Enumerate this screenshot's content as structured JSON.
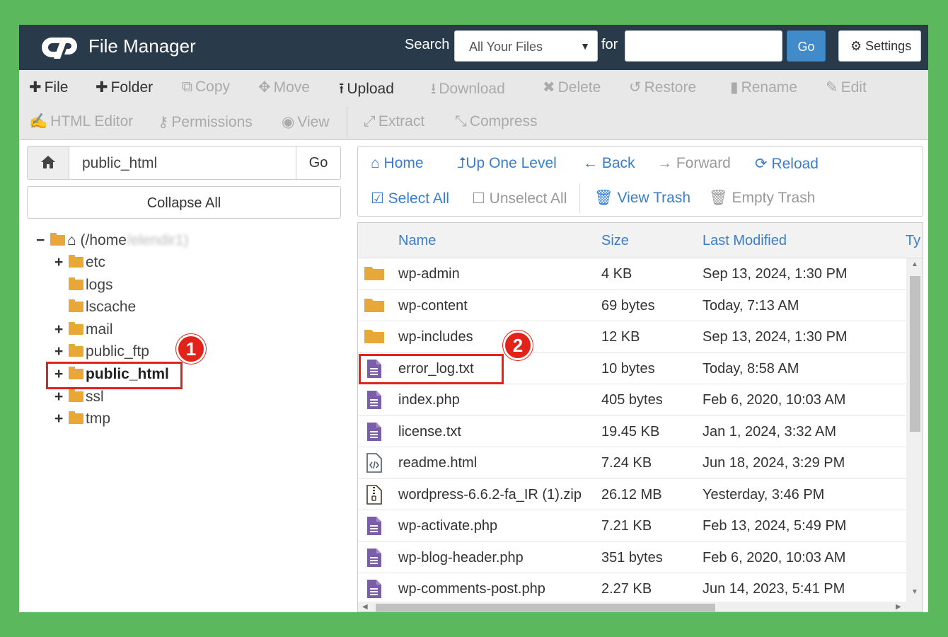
{
  "colors": {
    "background": "#5cb85c",
    "header": "#293a4a",
    "link": "#3a7dc9",
    "highlight": "#e2231a",
    "folder": "#e8a838",
    "file": "#7b5ea8"
  },
  "header": {
    "app_title": "File Manager",
    "search_label": "Search",
    "search_scope": "All Your Files",
    "for_label": "for",
    "search_value": "",
    "go": "Go",
    "settings": "Settings"
  },
  "toolbar": [
    {
      "label": "File",
      "icon": "plus-icon",
      "enabled": true
    },
    {
      "label": "Folder",
      "icon": "plus-icon",
      "enabled": true
    },
    {
      "label": "Copy",
      "icon": "copy-icon",
      "enabled": false
    },
    {
      "label": "Move",
      "icon": "move-icon",
      "enabled": false
    },
    {
      "label": "Upload",
      "icon": "upload-icon",
      "enabled": true
    },
    {
      "label": "Download",
      "icon": "download-icon",
      "enabled": false
    },
    {
      "label": "Delete",
      "icon": "delete-icon",
      "enabled": false
    },
    {
      "label": "Restore",
      "icon": "restore-icon",
      "enabled": false
    },
    {
      "label": "Rename",
      "icon": "file-icon",
      "enabled": false
    },
    {
      "label": "Edit",
      "icon": "pencil-icon",
      "enabled": false
    },
    {
      "label": "HTML Editor",
      "icon": "edit-icon",
      "enabled": false
    },
    {
      "label": "Permissions",
      "icon": "key-icon",
      "enabled": false
    },
    {
      "label": "View",
      "icon": "eye-icon",
      "enabled": false
    },
    {
      "label": "Extract",
      "icon": "expand-icon",
      "enabled": false
    },
    {
      "label": "Compress",
      "icon": "compress-icon",
      "enabled": false
    }
  ],
  "left": {
    "path_value": "public_html",
    "go": "Go",
    "collapse_all": "Collapse All",
    "tree_root": "(/home",
    "tree_root_obscured": "/elendir1)",
    "tree": [
      {
        "label": "etc",
        "expander": "+"
      },
      {
        "label": "logs",
        "expander": ""
      },
      {
        "label": "lscache",
        "expander": ""
      },
      {
        "label": "mail",
        "expander": "+"
      },
      {
        "label": "public_ftp",
        "expander": "+"
      },
      {
        "label": "public_html",
        "expander": "+",
        "selected": true
      },
      {
        "label": "ssl",
        "expander": "+"
      },
      {
        "label": "tmp",
        "expander": "+"
      }
    ],
    "root_expander": "−"
  },
  "nav": [
    {
      "label": "Home",
      "icon": "home-icon",
      "enabled": true
    },
    {
      "label": "Up One Level",
      "icon": "level-up-icon",
      "enabled": true
    },
    {
      "label": "Back",
      "icon": "arrow-left-icon",
      "enabled": true
    },
    {
      "label": "Forward",
      "icon": "arrow-right-icon",
      "enabled": false
    },
    {
      "label": "Reload",
      "icon": "refresh-icon",
      "enabled": true
    },
    {
      "label": "Select All",
      "icon": "checkbox-checked-icon",
      "enabled": true
    },
    {
      "label": "Unselect All",
      "icon": "checkbox-empty-icon",
      "enabled": false
    },
    {
      "label": "View Trash",
      "icon": "trash-icon",
      "enabled": true
    },
    {
      "label": "Empty Trash",
      "icon": "trash-icon",
      "enabled": false
    }
  ],
  "table": {
    "columns": [
      "Name",
      "Size",
      "Last Modified",
      "Ty"
    ],
    "rows": [
      {
        "name": "wp-admin",
        "size": "4 KB",
        "modified": "Sep 13, 2024, 1:30 PM",
        "kind": "folder"
      },
      {
        "name": "wp-content",
        "size": "69 bytes",
        "modified": "Today, 7:13 AM",
        "kind": "folder"
      },
      {
        "name": "wp-includes",
        "size": "12 KB",
        "modified": "Sep 13, 2024, 1:30 PM",
        "kind": "folder"
      },
      {
        "name": "error_log.txt",
        "size": "10 bytes",
        "modified": "Today, 8:58 AM",
        "kind": "text"
      },
      {
        "name": "index.php",
        "size": "405 bytes",
        "modified": "Feb 6, 2020, 10:03 AM",
        "kind": "text"
      },
      {
        "name": "license.txt",
        "size": "19.45 KB",
        "modified": "Jan 1, 2024, 3:32 AM",
        "kind": "text"
      },
      {
        "name": "readme.html",
        "size": "7.24 KB",
        "modified": "Jun 18, 2024, 3:29 PM",
        "kind": "code"
      },
      {
        "name": "wordpress-6.6.2-fa_IR (1).zip",
        "size": "26.12 MB",
        "modified": "Yesterday, 3:46 PM",
        "kind": "zip"
      },
      {
        "name": "wp-activate.php",
        "size": "7.21 KB",
        "modified": "Feb 13, 2024, 5:49 PM",
        "kind": "text"
      },
      {
        "name": "wp-blog-header.php",
        "size": "351 bytes",
        "modified": "Feb 6, 2020, 10:03 AM",
        "kind": "text"
      },
      {
        "name": "wp-comments-post.php",
        "size": "2.27 KB",
        "modified": "Jun 14, 2023, 5:41 PM",
        "kind": "text"
      }
    ]
  },
  "badges": [
    "1",
    "2"
  ]
}
